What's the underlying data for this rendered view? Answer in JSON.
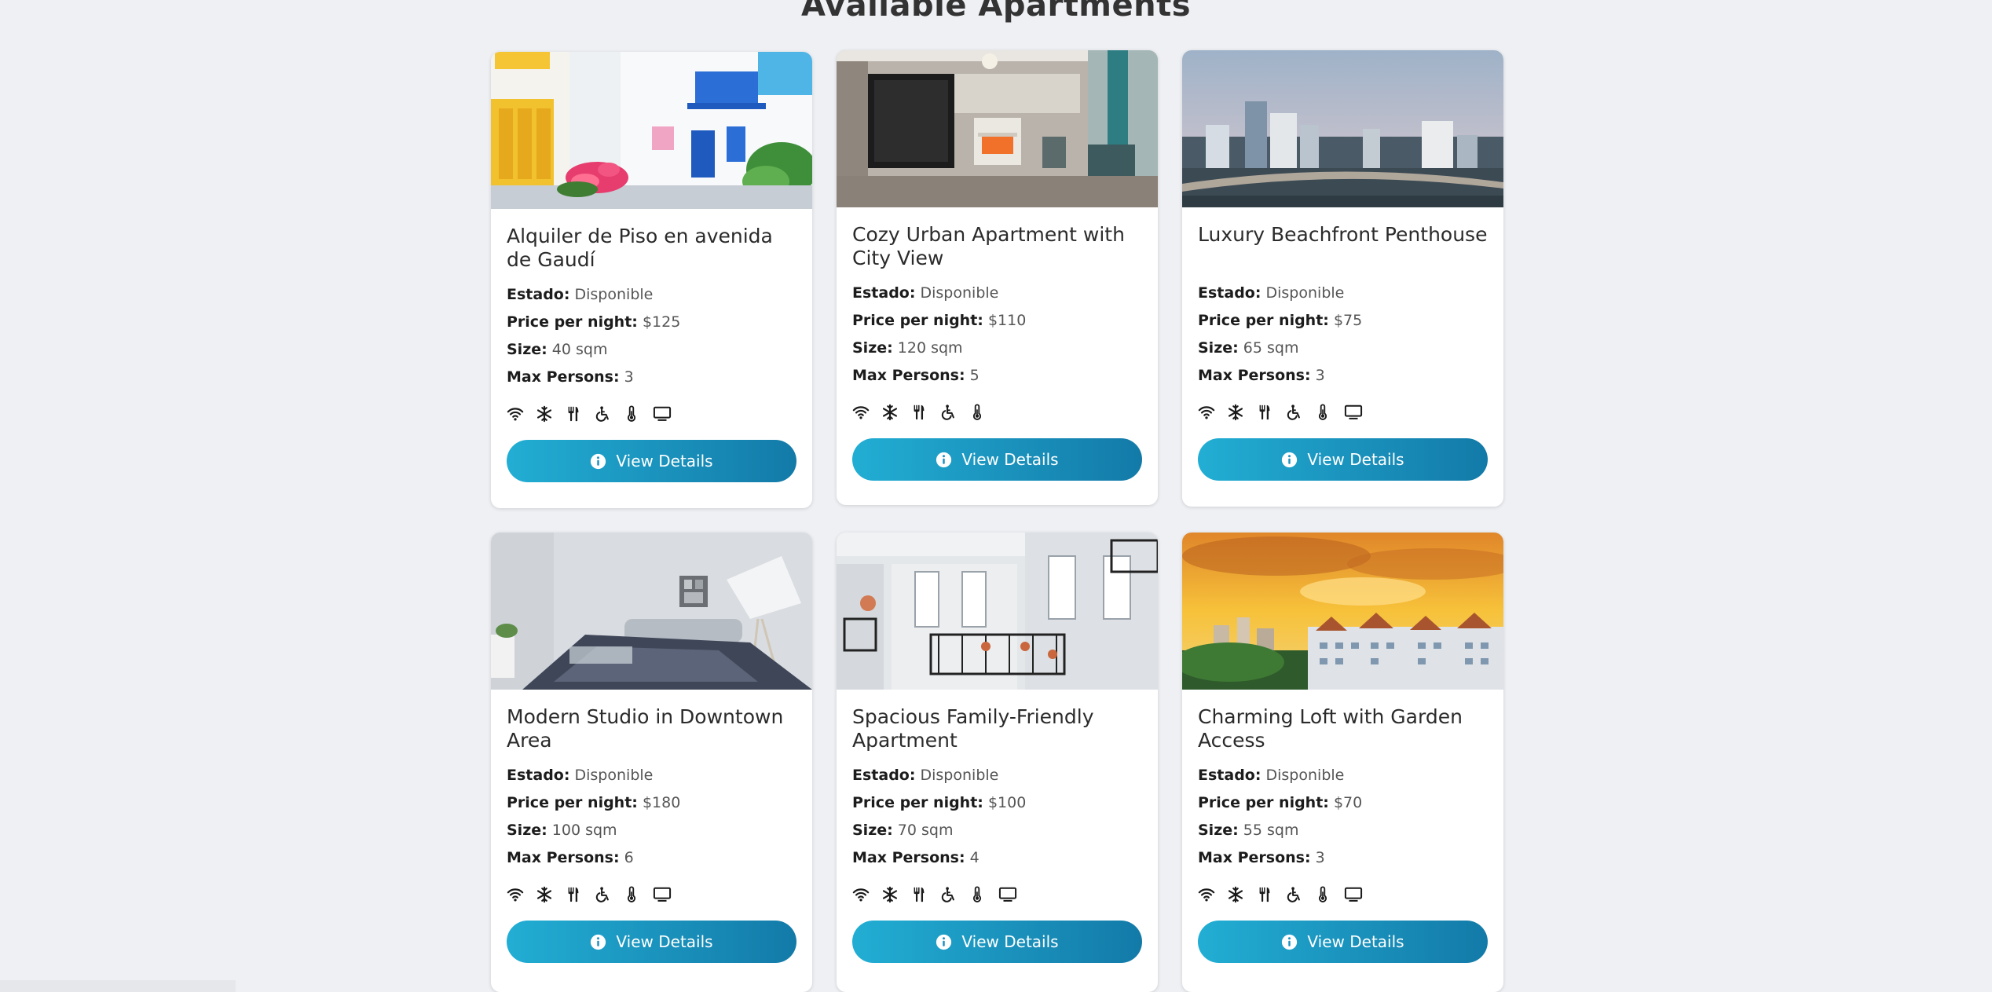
{
  "page": {
    "title": "Available Apartments"
  },
  "labels": {
    "status": "Estado:",
    "price": "Price per night:",
    "size": "Size:",
    "max_persons": "Max Persons:"
  },
  "button_label": "View Details",
  "colors": {
    "accent_start": "#22aed4",
    "accent_end": "#137aa8",
    "background": "#eef0f4"
  },
  "apartments": [
    {
      "title": "Alquiler de Piso en avenida de Gaudí",
      "status": "Disponible",
      "price": "$125",
      "size": "40 sqm",
      "max_persons": "3",
      "photo": "white-village-balconies",
      "amenities": [
        "wifi-icon",
        "snowflake-icon",
        "utensils-icon",
        "wheelchair-icon",
        "thermometer-icon",
        "tv-icon"
      ]
    },
    {
      "title": "Cozy Urban Apartment with City View",
      "status": "Disponible",
      "price": "$110",
      "size": "120 sqm",
      "max_persons": "5",
      "photo": "living-room-fireplace",
      "amenities": [
        "wifi-icon",
        "snowflake-icon",
        "utensils-icon",
        "wheelchair-icon",
        "thermometer-icon"
      ]
    },
    {
      "title": "Luxury Beachfront Penthouse",
      "status": "Disponible",
      "price": "$75",
      "size": "65 sqm",
      "max_persons": "3",
      "photo": "city-skyline",
      "amenities": [
        "wifi-icon",
        "snowflake-icon",
        "utensils-icon",
        "wheelchair-icon",
        "thermometer-icon",
        "tv-icon"
      ]
    },
    {
      "title": "Modern Studio in Downtown Area",
      "status": "Disponible",
      "price": "$180",
      "size": "100 sqm",
      "max_persons": "6",
      "photo": "studio-sofa",
      "amenities": [
        "wifi-icon",
        "snowflake-icon",
        "utensils-icon",
        "wheelchair-icon",
        "thermometer-icon",
        "tv-icon"
      ]
    },
    {
      "title": "Spacious Family-Friendly Apartment",
      "status": "Disponible",
      "price": "$100",
      "size": "70 sqm",
      "max_persons": "4",
      "photo": "facade-balconies",
      "amenities": [
        "wifi-icon",
        "snowflake-icon",
        "utensils-icon",
        "wheelchair-icon",
        "thermometer-icon",
        "tv-icon"
      ]
    },
    {
      "title": "Charming Loft with Garden Access",
      "status": "Disponible",
      "price": "$70",
      "size": "55 sqm",
      "max_persons": "3",
      "photo": "sunset-buildings",
      "amenities": [
        "wifi-icon",
        "snowflake-icon",
        "utensils-icon",
        "wheelchair-icon",
        "thermometer-icon",
        "tv-icon"
      ]
    }
  ]
}
